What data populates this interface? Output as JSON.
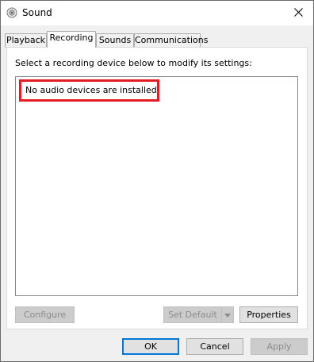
{
  "window": {
    "title": "Sound",
    "icons": {
      "app": "speaker-icon",
      "close": "close-icon"
    }
  },
  "tabs": [
    {
      "label": "Playback",
      "active": false
    },
    {
      "label": "Recording",
      "active": true
    },
    {
      "label": "Sounds",
      "active": false
    },
    {
      "label": "Communications",
      "active": false
    }
  ],
  "recording": {
    "instruction": "Select a recording device below to modify its settings:",
    "empty_message": "No audio devices are installed",
    "highlight_color": "#e31b23"
  },
  "panel_buttons": {
    "configure": "Configure",
    "set_default": "Set Default",
    "properties": "Properties"
  },
  "dialog_buttons": {
    "ok": "OK",
    "cancel": "Cancel",
    "apply": "Apply"
  },
  "colors": {
    "accent": "#0078d7",
    "disabled_bg": "#cccccc",
    "disabled_text": "#8c8c8c"
  }
}
